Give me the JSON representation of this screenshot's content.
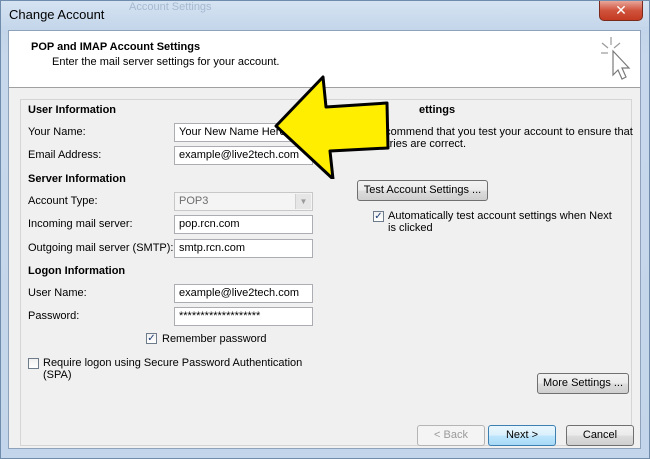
{
  "window": {
    "title": "Change Account",
    "close_glyph": "✕"
  },
  "header": {
    "title": "POP and IMAP Account Settings",
    "subtitle": "Enter the mail server settings for your account.",
    "icon": "cursor-sparkle-icon"
  },
  "user_info": {
    "section_title": "User Information",
    "name_label": "Your Name:",
    "name_value": "Your New Name Here",
    "email_label": "Email Address:",
    "email_value": "example@live2tech.com"
  },
  "server_info": {
    "section_title": "Server Information",
    "account_type_label": "Account Type:",
    "account_type_value": "POP3",
    "incoming_label": "Incoming mail server:",
    "incoming_value": "pop.rcn.com",
    "outgoing_label": "Outgoing mail server (SMTP):",
    "outgoing_value": "smtp.rcn.com"
  },
  "logon_info": {
    "section_title": "Logon Information",
    "username_label": "User Name:",
    "username_value": "example@live2tech.com",
    "password_label": "Password:",
    "password_value": "*******************",
    "remember_label": "Remember password",
    "remember_checked": true,
    "spa_label_line1": "Require logon using Secure Password Authentication",
    "spa_label_line2": "(SPA)",
    "spa_checked": false
  },
  "test_settings": {
    "section_title_visible": "T",
    "section_title_visible_end": "ettings",
    "description": "We recommend that you test your account to ensure that",
    "description_line2": "the entries are correct.",
    "test_button": "Test Account Settings ...",
    "auto_test_label_line1": "Automatically test account settings when Next",
    "auto_test_label_line2": "is clicked",
    "auto_test_checked": true
  },
  "buttons": {
    "more_settings": "More Settings ...",
    "back": "< Back",
    "next": "Next >",
    "cancel": "Cancel"
  },
  "annotation": {
    "arrow_color": "#ffee00",
    "arrow_outline": "#000000"
  },
  "ghost": {
    "background_text": "Account Settings"
  }
}
